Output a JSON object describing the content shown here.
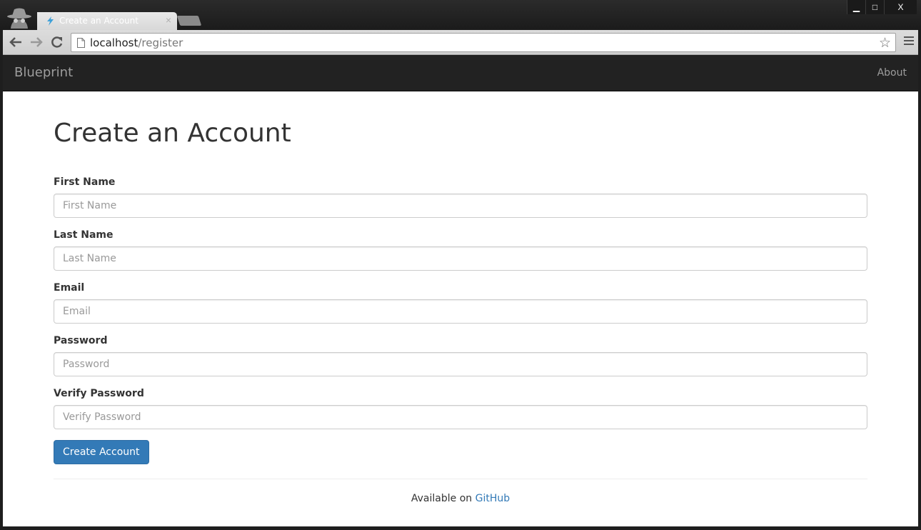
{
  "browser": {
    "tab_title": "Create an Account",
    "tab_close": "×",
    "url_host": "localhost",
    "url_path": "/register",
    "window_controls": {
      "minimize": "▁",
      "maximize": "□",
      "close": "X"
    }
  },
  "navbar": {
    "brand": "Blueprint",
    "about": "About"
  },
  "page": {
    "title": "Create an Account",
    "fields": [
      {
        "label": "First Name",
        "placeholder": "First Name"
      },
      {
        "label": "Last Name",
        "placeholder": "Last Name"
      },
      {
        "label": "Email",
        "placeholder": "Email"
      },
      {
        "label": "Password",
        "placeholder": "Password"
      },
      {
        "label": "Verify Password",
        "placeholder": "Verify Password"
      }
    ],
    "submit_label": "Create Account"
  },
  "footer": {
    "prefix": "Available on ",
    "link": "GitHub"
  },
  "colors": {
    "navbar_bg": "#222222",
    "primary": "#337ab7"
  }
}
